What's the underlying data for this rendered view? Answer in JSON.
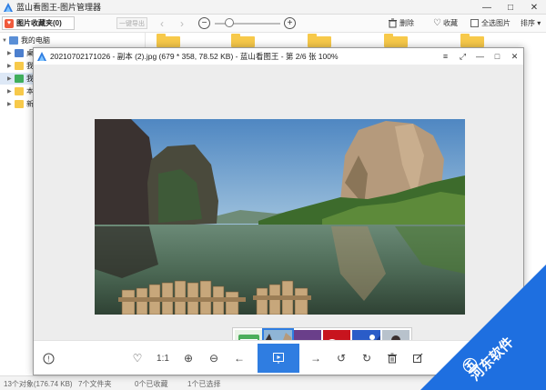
{
  "app": {
    "title": "蓝山看图王-图片管理器",
    "window_controls": [
      "—",
      "□",
      "✕"
    ]
  },
  "toolbar": {
    "favorites_label": "图片收藏夹(0)",
    "export_label": "一键导出",
    "back_arrow": "‹",
    "forward_arrow": "›",
    "zoom_out": "−",
    "zoom_in": "+",
    "zoom_level": 0.22,
    "delete_label": "删除",
    "collect_label": "收藏",
    "select_all_label": "全选图片",
    "sort_label": "排序 ▾"
  },
  "tree": {
    "items": [
      {
        "label": "我的电脑",
        "icon": "computer-icon"
      },
      {
        "label": "桌面",
        "icon": "desktop-icon"
      },
      {
        "label": "我的",
        "icon": "folder-icon"
      },
      {
        "label": "我的",
        "icon": "filter-icon"
      },
      {
        "label": "本地",
        "icon": "folder-icon"
      },
      {
        "label": "新加",
        "icon": "folder-icon"
      }
    ]
  },
  "status": {
    "objects": "13个对象(176.74 KB)",
    "folders": "7个文件夹",
    "favorites": "0个已收藏",
    "selected": "1个已选择"
  },
  "viewer": {
    "title": "20210702171026 - 副本 (2).jpg (679 * 358, 78.52 KB) - 蓝山看图王 - 第 2/6 张 100%",
    "controls": [
      "≡",
      "⤢",
      "—",
      "□",
      "✕"
    ],
    "thumbnails": [
      "calendar-thumb",
      "lake-thumb",
      "dusk-thumb",
      "coca-cola-thumb",
      "blue-sky-thumb",
      "person-thumb"
    ],
    "active_thumb": 1,
    "toolbar": {
      "info": "!",
      "favorite": "♡",
      "actual_size": "1:1",
      "zoom_in": "⊕",
      "zoom_out": "⊖",
      "prev": "←",
      "next": "→",
      "rotate_left": "↺",
      "rotate_right": "↻",
      "delete": "🗑",
      "edit": "✎"
    }
  },
  "watermark": {
    "text": "河东软件",
    "logo": "㊄"
  },
  "colors": {
    "accent": "#2f7de1",
    "watermark_blue": "#1e6fe0",
    "folder_yellow": "#f7c94a",
    "favorites_red": "#f05a3c"
  }
}
